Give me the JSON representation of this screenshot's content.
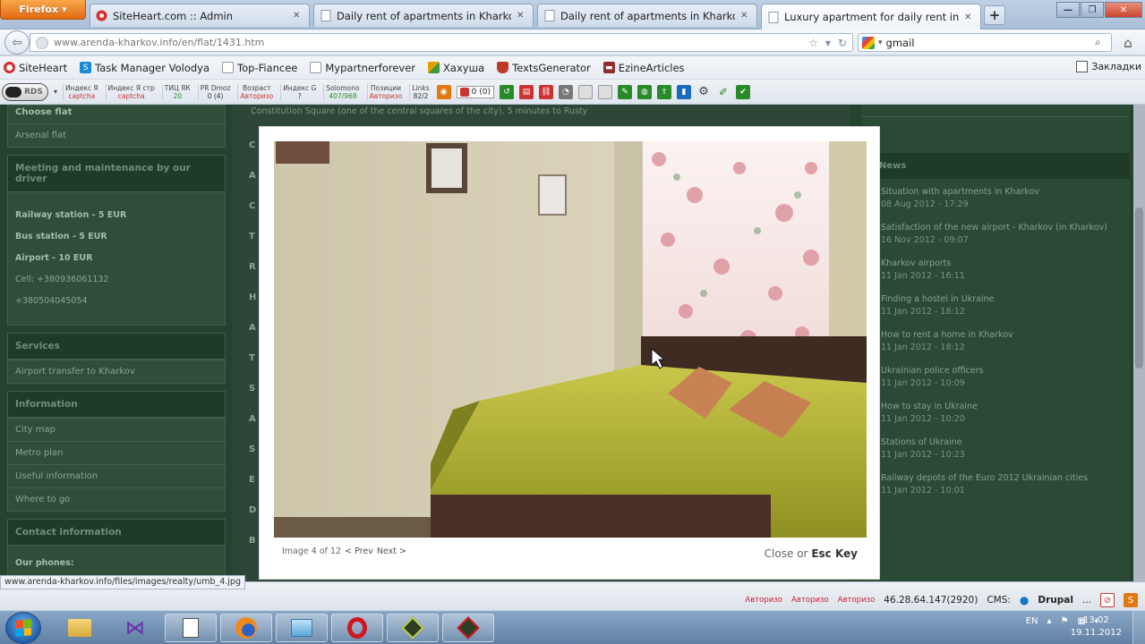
{
  "browser": {
    "menu_button": "Firefox",
    "tabs": [
      {
        "label": "SiteHeart.com :: Admin",
        "active": false
      },
      {
        "label": "Daily rent of apartments in Kharkov. ...",
        "active": false
      },
      {
        "label": "Daily rent of apartments in Kharkov. ...",
        "active": false
      },
      {
        "label": "Luxury apartment for daily rent in Kh...",
        "active": true
      }
    ],
    "new_tab": "+",
    "url": "www.arenda-kharkov.info/en/flat/1431.htm",
    "search_value": "gmail",
    "bookmarks": [
      {
        "label": "SiteHeart",
        "icon": "siteheart-icon",
        "color": "#d72b2b"
      },
      {
        "label": "Task Manager Volodya",
        "icon": "skype-icon",
        "color": "#1a8ad4"
      },
      {
        "label": "Top-Fiancee",
        "icon": "page-icon",
        "color": "#ffffff"
      },
      {
        "label": "Mypartnerforever",
        "icon": "page-icon",
        "color": "#ffffff"
      },
      {
        "label": "Хахуша",
        "icon": "puzzle-icon",
        "color": "#e0a000"
      },
      {
        "label": "TextsGenerator",
        "icon": "shield-icon",
        "color": "#c0392b"
      },
      {
        "label": "EzineArticles",
        "icon": "car-icon",
        "color": "#8e2f2f"
      }
    ],
    "bookmarks_right": "Закладки",
    "seo_toolbar": {
      "rds_label": "RDS",
      "items": [
        {
          "label": "Индекс Я",
          "value": "captcha"
        },
        {
          "label": "Индекс Я стр",
          "value": "captcha"
        },
        {
          "label": "ТИЦ ЯК",
          "value": "20"
        },
        {
          "label": "PR Dmoz",
          "value": "0 (4)"
        },
        {
          "label": "Возраст",
          "value": "Авторизо"
        },
        {
          "label": "Индекс G",
          "value": "?"
        },
        {
          "label": "Solomono",
          "value": "407/968"
        },
        {
          "label": "Позиции",
          "value": "Авторизо"
        },
        {
          "label": "Links",
          "value": "82/2"
        }
      ],
      "counter": "0 (0)"
    }
  },
  "page": {
    "top_text": "Constitution Square (one of the central squares of the city), 5 minutes to Rusty",
    "sidebar": {
      "top_item": "Choose flat",
      "first_link": "Arsenal flat",
      "meeting": {
        "title": "Meeting and maintenance by our driver",
        "lines": [
          "Railway station - 5 EUR",
          "Bus station - 5 EUR",
          "Airport - 10 EUR",
          "Cell: +380936061132",
          "+380504045054"
        ]
      },
      "services": {
        "title": "Services",
        "items": [
          "Airport transfer to Kharkov"
        ]
      },
      "information": {
        "title": "Information",
        "items": [
          "City map",
          "Metro plan",
          "Useful information",
          "Where to go"
        ]
      },
      "contact": {
        "title": "Contact information",
        "subtitle": "Our phones:"
      }
    },
    "letters": [
      "C",
      "A",
      "C",
      "T",
      "R",
      "H",
      "A",
      "T",
      "S",
      "A",
      "S",
      "E",
      "D",
      "B"
    ],
    "right_col": {
      "heading": "News",
      "news": [
        {
          "title": "Situation with apartments in Kharkov",
          "date": "08 Aug 2012 - 17:29"
        },
        {
          "title": "Satisfaction of the new airport - Kharkov (in Kharkov)",
          "date": "16 Nov 2012 - 09:07"
        },
        {
          "title": "Kharkov airports",
          "date": "11 Jan 2012 - 16:11"
        },
        {
          "title": "Finding a hostel in Ukraine",
          "date": "11 Jan 2012 - 18:12"
        },
        {
          "title": "How to rent a home in Kharkov",
          "date": "11 Jan 2012 - 18:12"
        },
        {
          "title": "Ukrainian police officers",
          "date": "11 Jan 2012 - 10:09"
        },
        {
          "title": "How to stay in Ukraine",
          "date": "11 Jan 2012 - 10:20"
        },
        {
          "title": "Stations of Ukraine",
          "date": "11 Jan 2012 - 10:23"
        },
        {
          "title": "Railway depots of the Euro 2012 Ukrainian cities",
          "date": "11 Jan 2012 - 10:01"
        }
      ]
    }
  },
  "lightbox": {
    "caption": "Image 4 of 12",
    "prev": "< Prev",
    "next": "Next >",
    "close_word": "Close",
    "or_word": "or",
    "esc_key": "Esc Key"
  },
  "status": {
    "hover_url": "www.arenda-kharkov.info/files/images/realty/umb_4.jpg",
    "seo_labels": [
      "Авторизо",
      "Авторизо",
      "Авторизо"
    ],
    "ip": "46.28.64.147(2920)",
    "cms_label": "CMS:",
    "cms_value": "Drupal",
    "ellipsis": "..."
  },
  "taskbar": {
    "lang": "EN",
    "time": "13:02",
    "date": "19.11.2012"
  },
  "colors": {
    "page_bg": "#24432f",
    "firefox_orange": "#e26a12",
    "seo_red": "#c33333"
  }
}
